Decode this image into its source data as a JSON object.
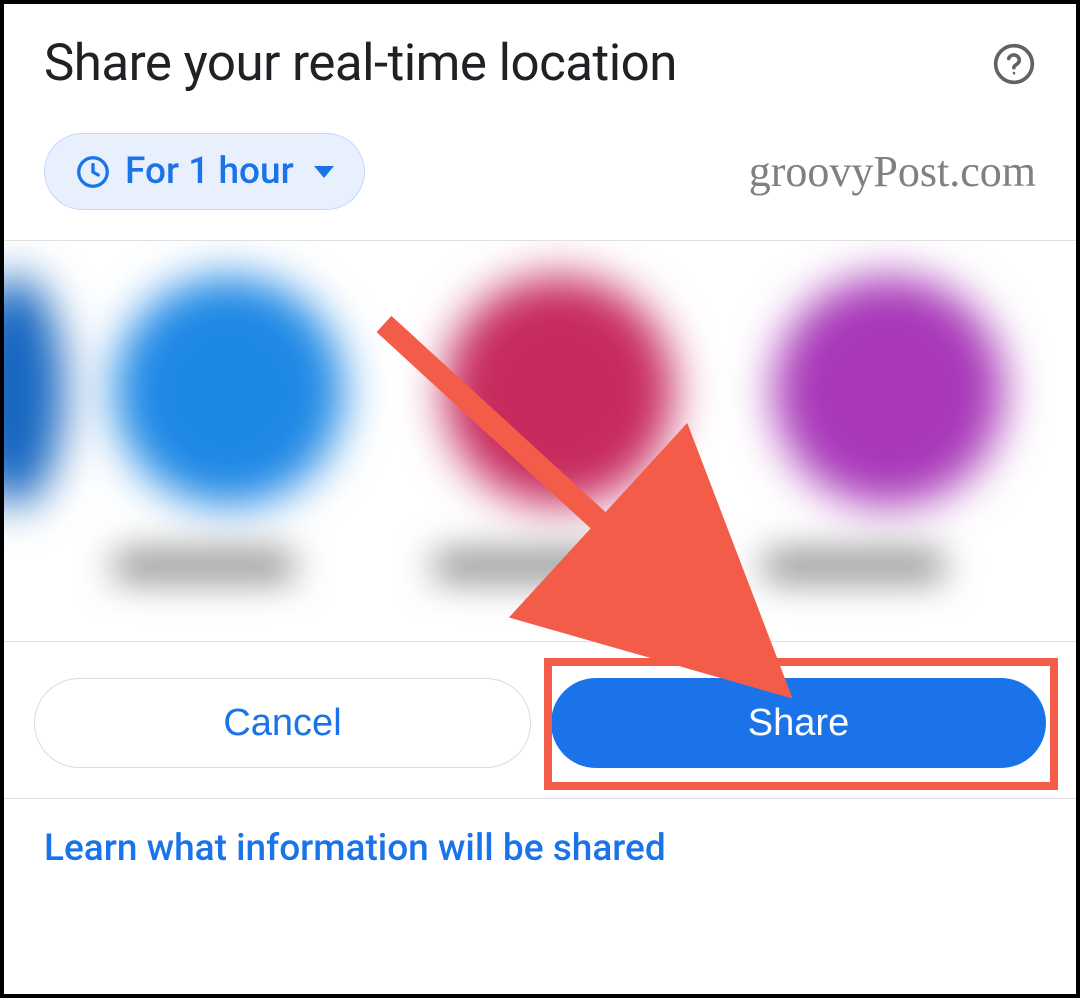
{
  "header": {
    "title": "Share your real-time location"
  },
  "duration": {
    "label": "For 1 hour"
  },
  "watermark": "groovyPost.com",
  "buttons": {
    "cancel": "Cancel",
    "share": "Share"
  },
  "footer": {
    "link": "Learn what information will be shared"
  },
  "colors": {
    "primary": "#1a73e8",
    "chip_bg": "#e8f0fe",
    "highlight": "#f25c49"
  }
}
